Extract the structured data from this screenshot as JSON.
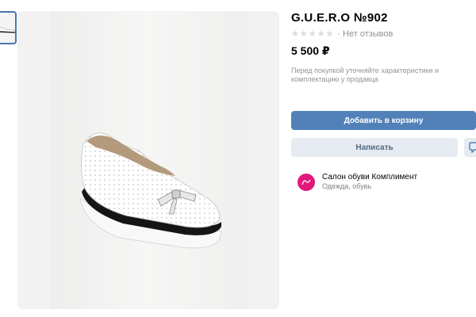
{
  "product": {
    "title": "G.U.E.R.O №902",
    "rating_stars": "★★★★★",
    "reviews": "· Нет отзывов",
    "price": "5 500 ₽",
    "note": "Перед покупкой уточняйте характеристики и комплектацию у продавца"
  },
  "actions": {
    "add_to_cart": "Добавить в корзину",
    "write": "Написать"
  },
  "seller": {
    "name": "Салон обуви Комплимент",
    "category": "Одежда, обувь"
  },
  "icons": {
    "message": "message-bubble-icon",
    "avatar": "seller-avatar-icon"
  },
  "colors": {
    "primary": "#5181b8",
    "secondary_bg": "#e5ebf1",
    "muted_text": "#939393",
    "avatar": "#e2187b"
  }
}
